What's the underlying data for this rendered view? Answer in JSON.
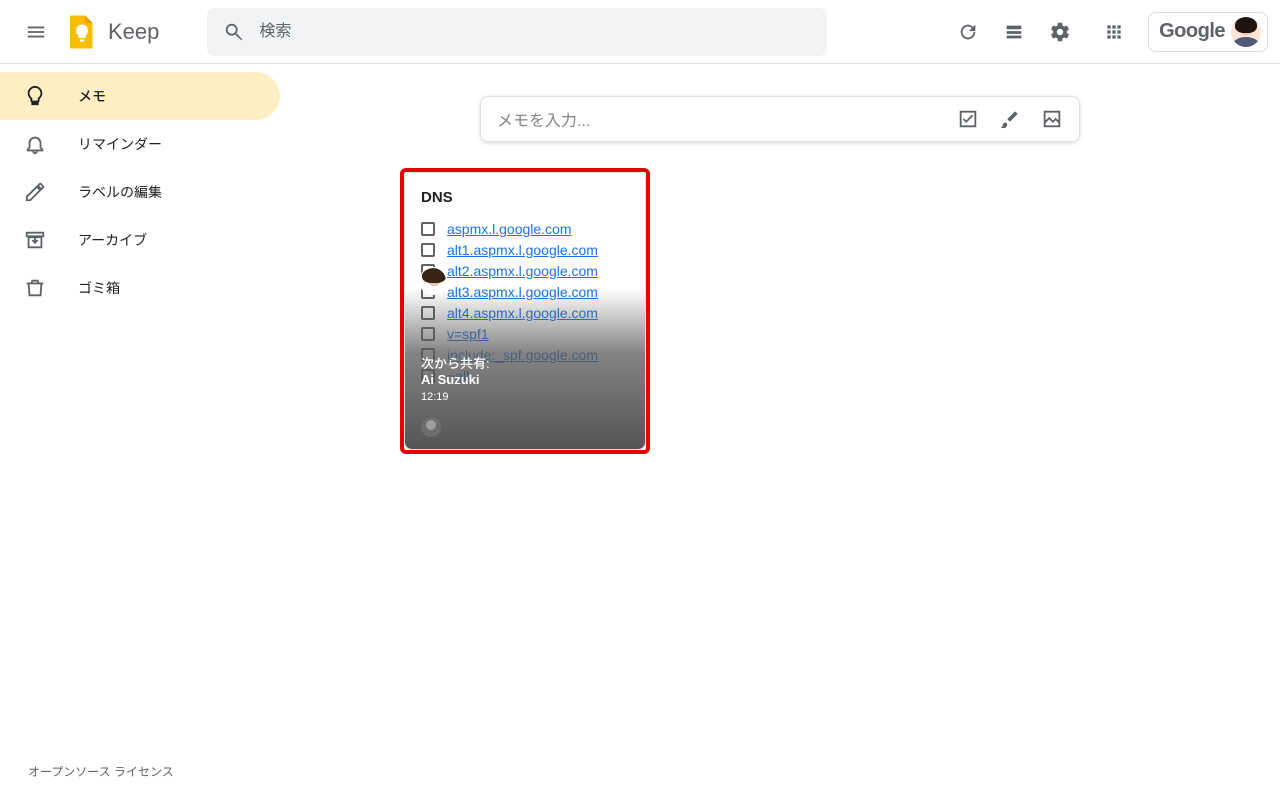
{
  "app": {
    "name": "Keep"
  },
  "search": {
    "placeholder": "検索"
  },
  "google_word": "Google",
  "sidebar": {
    "items": [
      {
        "label": "メモ"
      },
      {
        "label": "リマインダー"
      },
      {
        "label": "ラベルの編集"
      },
      {
        "label": "アーカイブ"
      },
      {
        "label": "ゴミ箱"
      }
    ]
  },
  "composer": {
    "placeholder": "メモを入力..."
  },
  "note": {
    "title": "DNS",
    "items": [
      "aspmx.l.google.com",
      "alt1.aspmx.l.google.com",
      "alt2.aspmx.l.google.com",
      "alt3.aspmx.l.google.com",
      "alt4.aspmx.l.google.com",
      "v=spf1",
      "include:_spf.google.com",
      "~all"
    ],
    "shared_label": "次から共有:",
    "shared_by": "Ai Suzuki",
    "shared_time": "12:19"
  },
  "footer": {
    "licenses": "オープンソース ライセンス"
  }
}
